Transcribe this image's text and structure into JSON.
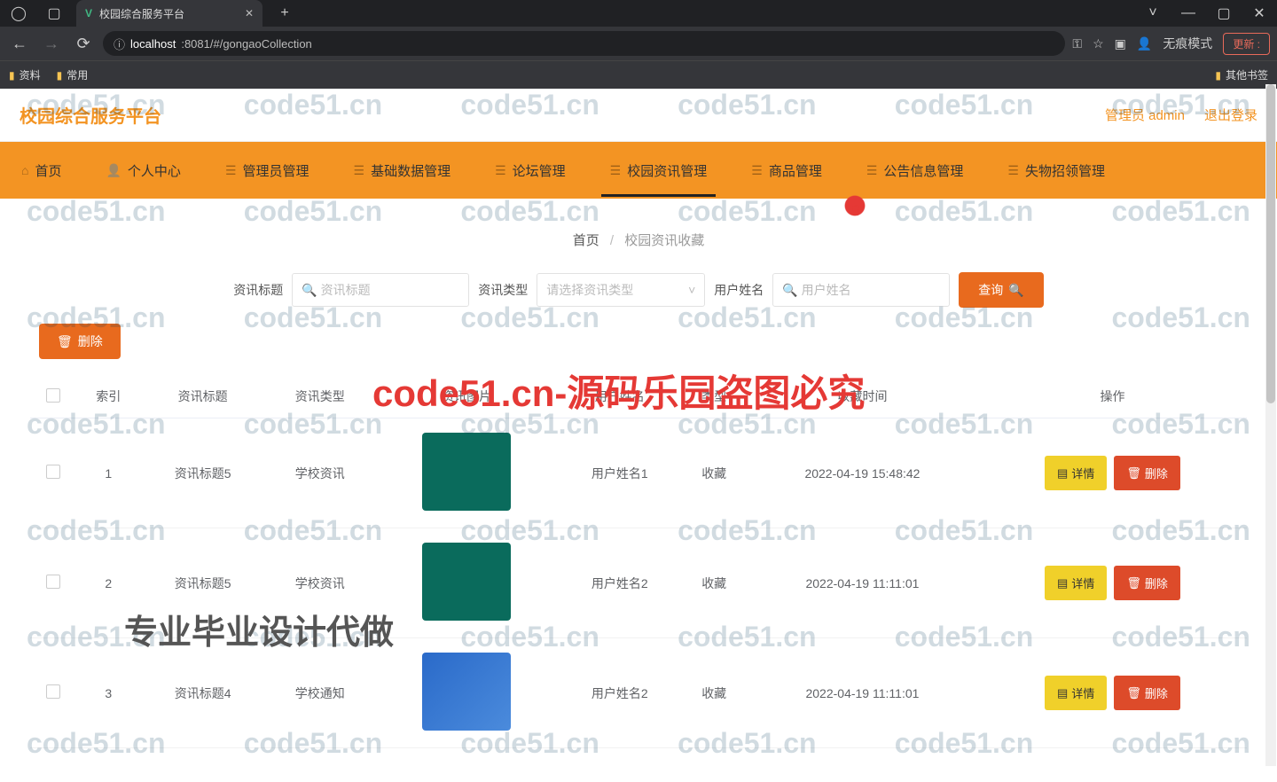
{
  "browser": {
    "tab_title": "校园综合服务平台",
    "url_prefix": "localhost",
    "url_suffix": ":8081/#/gongaoCollection",
    "incognito": "无痕模式",
    "update": "更新",
    "bookmarks": {
      "item1": "资料",
      "item2": "常用",
      "right": "其他书签"
    }
  },
  "header": {
    "logo": "校园综合服务平台",
    "admin": "管理员 admin",
    "logout": "退出登录"
  },
  "nav": {
    "items": [
      {
        "label": "首页"
      },
      {
        "label": "个人中心"
      },
      {
        "label": "管理员管理"
      },
      {
        "label": "基础数据管理"
      },
      {
        "label": "论坛管理"
      },
      {
        "label": "校园资讯管理"
      },
      {
        "label": "商品管理"
      },
      {
        "label": "公告信息管理"
      },
      {
        "label": "失物招领管理"
      }
    ]
  },
  "breadcrumb": {
    "home": "首页",
    "sep": "/",
    "current": "校园资讯收藏"
  },
  "search": {
    "label_title": "资讯标题",
    "ph_title": "资讯标题",
    "label_type": "资讯类型",
    "ph_type": "请选择资讯类型",
    "label_user": "用户姓名",
    "ph_user": "用户姓名",
    "query": "查询"
  },
  "actions": {
    "batch_delete": "删除",
    "detail": "详情",
    "delete": "删除"
  },
  "table": {
    "columns": [
      "索引",
      "资讯标题",
      "资讯类型",
      "资讯图片",
      "用户姓名",
      "类型",
      "收藏时间",
      "操作"
    ],
    "rows": [
      {
        "idx": "1",
        "title": "资讯标题5",
        "type": "学校资讯",
        "user": "用户姓名1",
        "cat": "收藏",
        "time": "2022-04-19 15:48:42",
        "thumb": "a"
      },
      {
        "idx": "2",
        "title": "资讯标题5",
        "type": "学校资讯",
        "user": "用户姓名2",
        "cat": "收藏",
        "time": "2022-04-19 11:11:01",
        "thumb": "b"
      },
      {
        "idx": "3",
        "title": "资讯标题4",
        "type": "学校通知",
        "user": "用户姓名2",
        "cat": "收藏",
        "time": "2022-04-19 11:11:01",
        "thumb": "c"
      }
    ]
  },
  "watermark": {
    "text": "code51.cn",
    "big": "code51.cn-源码乐园盗图必究",
    "sub": "专业毕业设计代做"
  }
}
